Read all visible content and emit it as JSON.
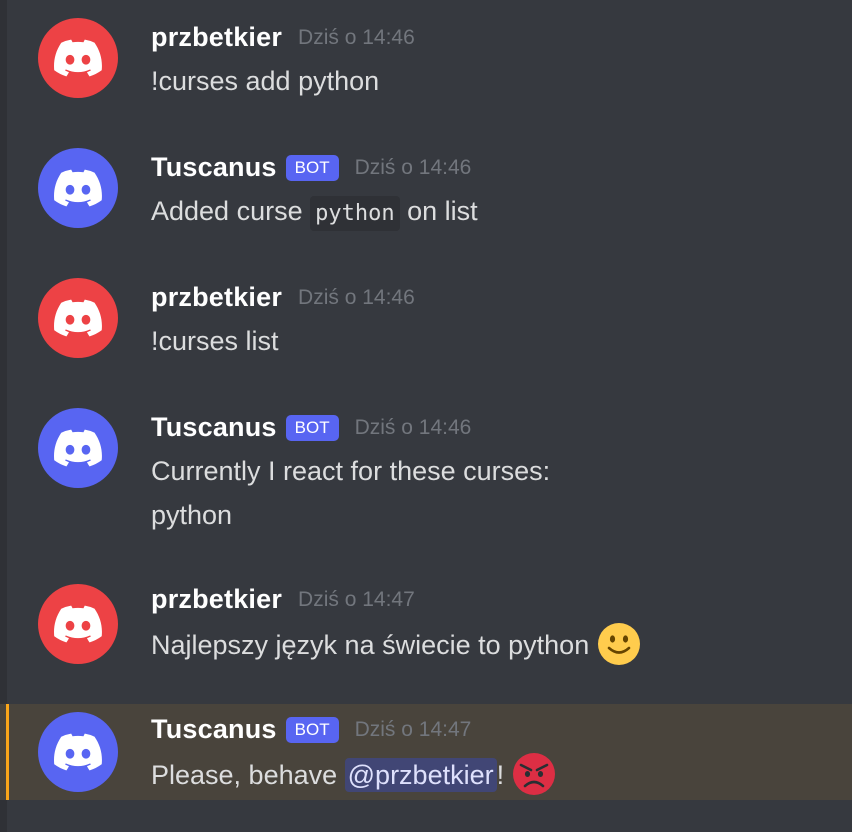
{
  "colors": {
    "user_avatar": "#ed4245",
    "bot_avatar": "#5865f2",
    "bot_tag": "#5865f2",
    "mention_bg": "#414675",
    "highlight_bar": "#faa61a"
  },
  "messages": [
    {
      "author": "przbetkier",
      "is_bot": false,
      "timestamp": "Dziś o 14:46",
      "text": "!curses add python"
    },
    {
      "author": "Tuscanus",
      "is_bot": true,
      "bot_tag": "BOT",
      "timestamp": "Dziś o 14:46",
      "text_before": "Added curse ",
      "code": "python",
      "text_after": " on list"
    },
    {
      "author": "przbetkier",
      "is_bot": false,
      "timestamp": "Dziś o 14:46",
      "text": "!curses list"
    },
    {
      "author": "Tuscanus",
      "is_bot": true,
      "bot_tag": "BOT",
      "timestamp": "Dziś o 14:46",
      "line1": "Currently I react for these curses:",
      "line2": "python"
    },
    {
      "author": "przbetkier",
      "is_bot": false,
      "timestamp": "Dziś o 14:47",
      "text": "Najlepszy język na świecie to python ",
      "emoji": "slightly-smiling-face-icon"
    },
    {
      "author": "Tuscanus",
      "is_bot": true,
      "bot_tag": "BOT",
      "timestamp": "Dziś o 14:47",
      "text_before": "Please, behave ",
      "mention": "@przbetkier",
      "text_after": "! ",
      "emoji": "angry-face-icon",
      "highlighted": true
    }
  ]
}
